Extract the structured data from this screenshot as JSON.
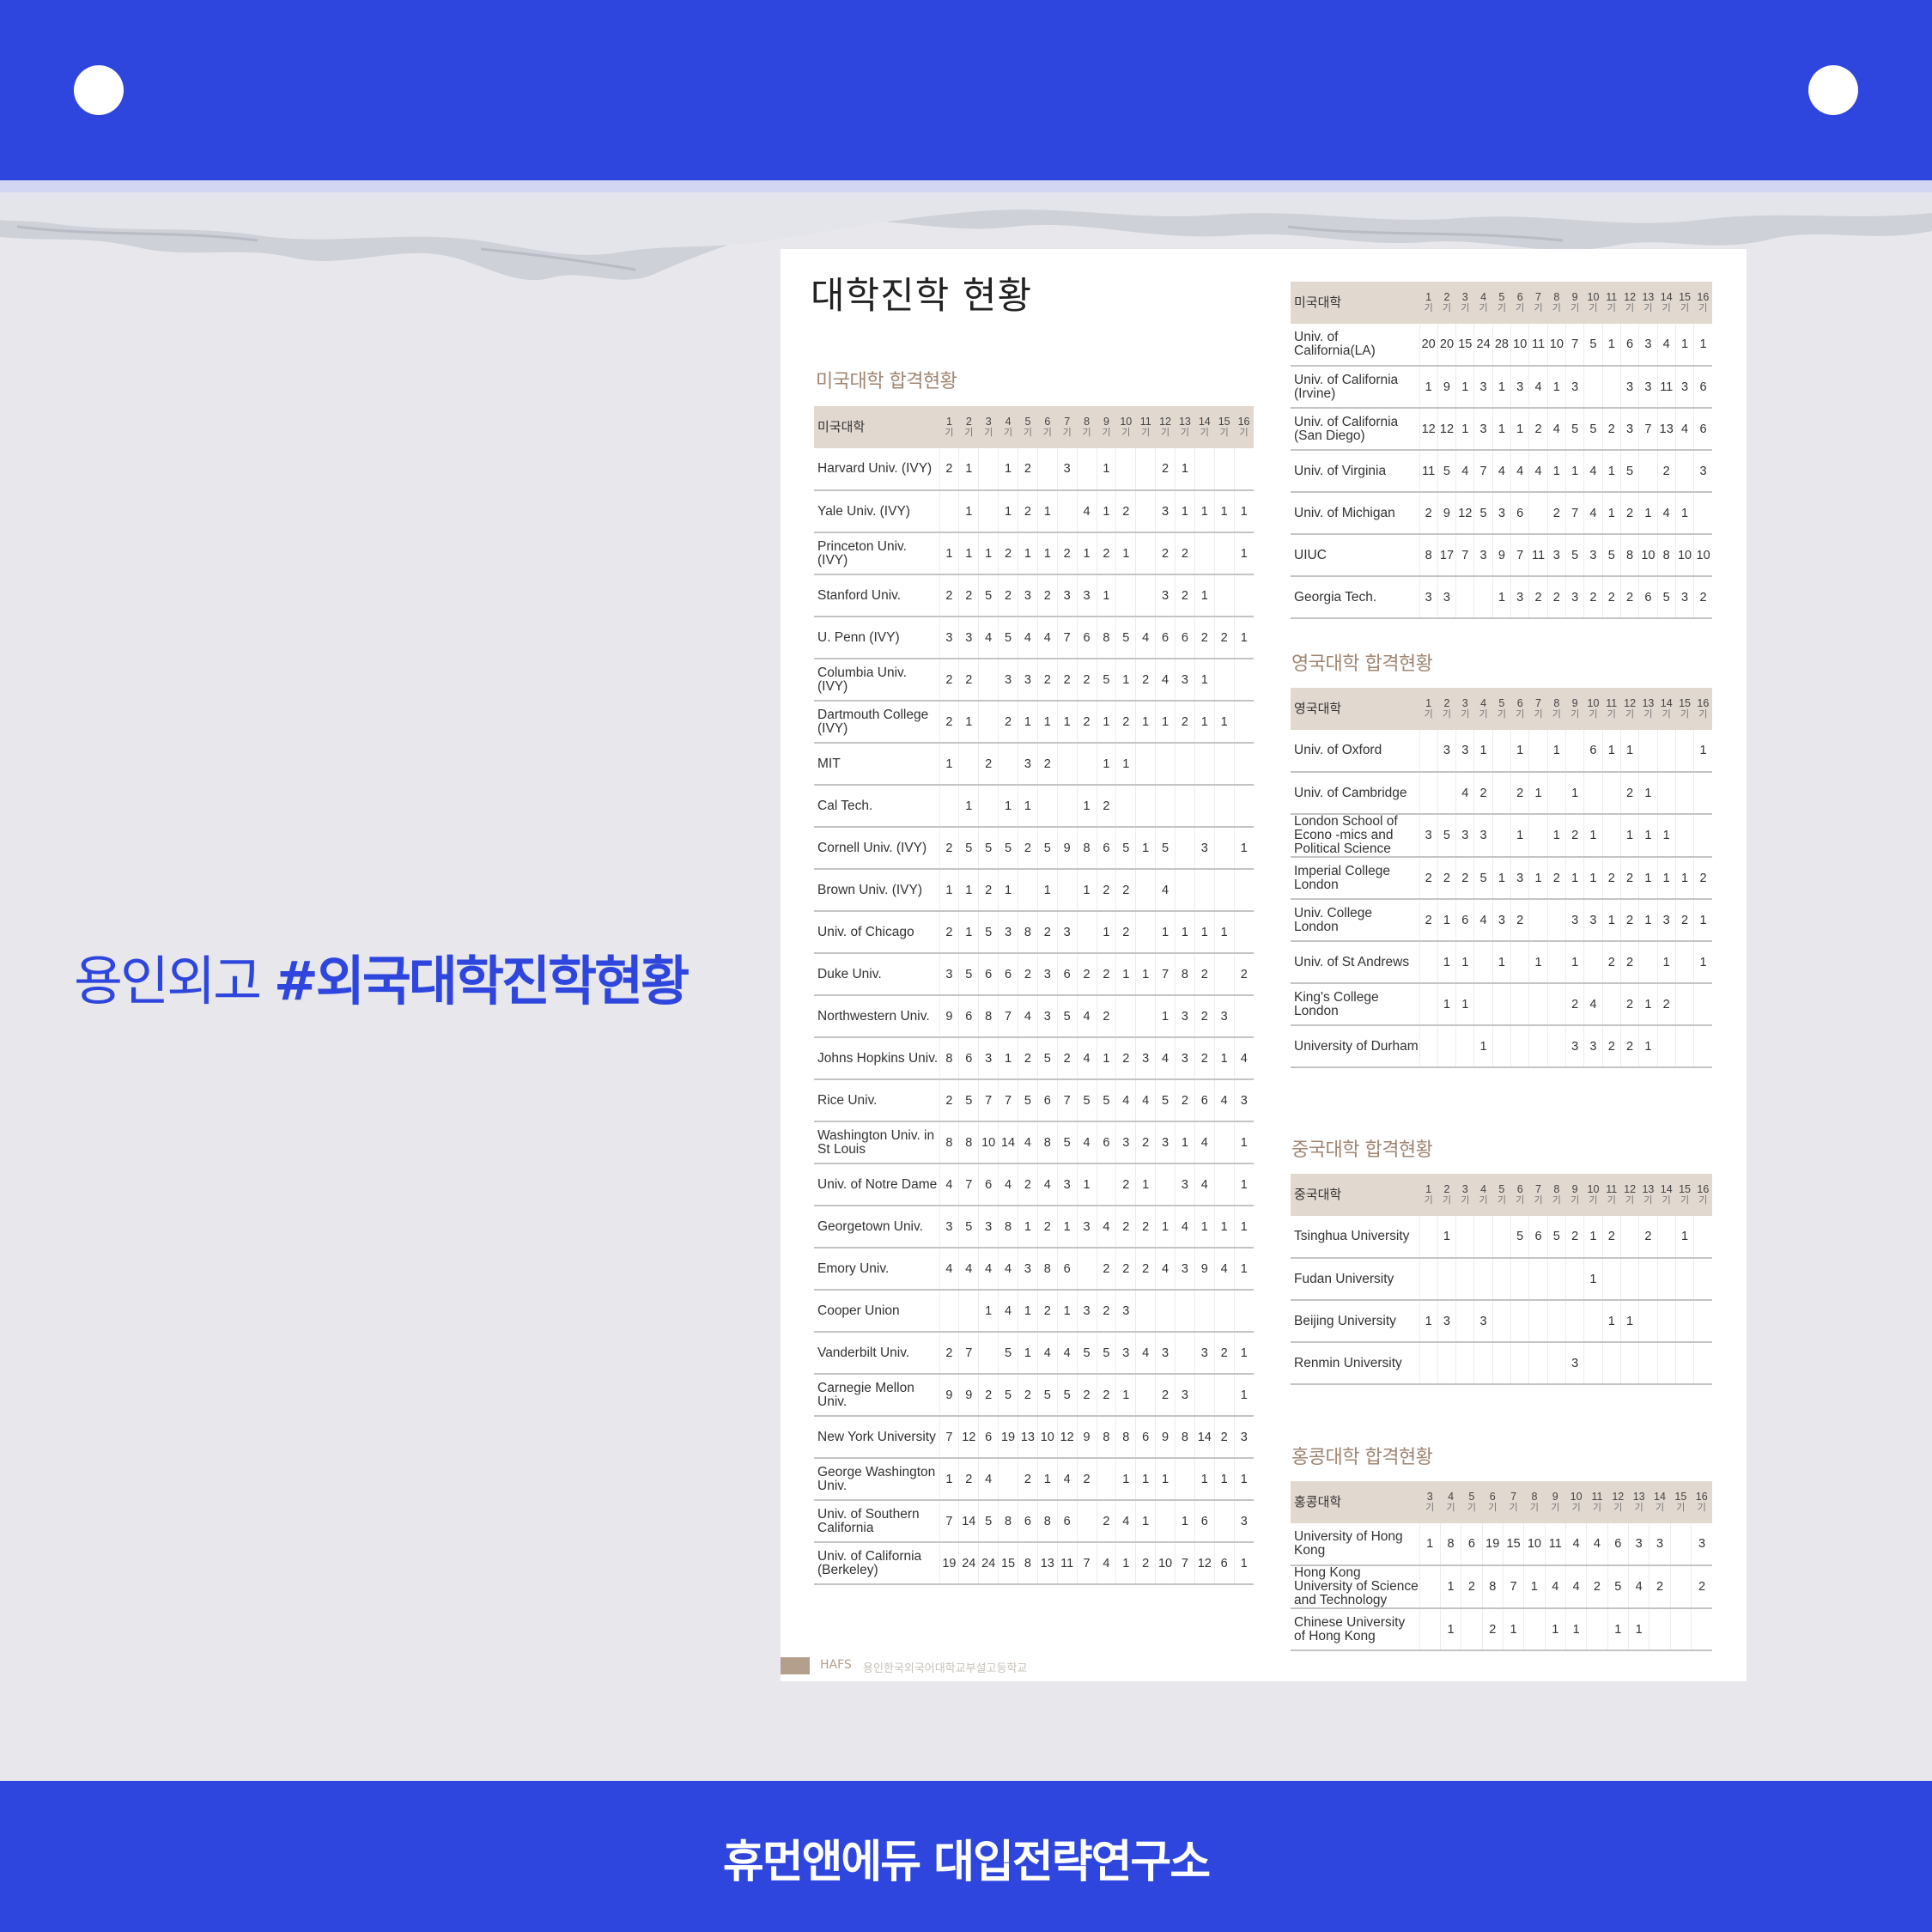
{
  "cols16": [
    "1",
    "2",
    "3",
    "4",
    "5",
    "6",
    "7",
    "8",
    "9",
    "10",
    "11",
    "12",
    "13",
    "14",
    "15",
    "16"
  ],
  "cols14": [
    "3",
    "4",
    "5",
    "6",
    "7",
    "8",
    "9",
    "10",
    "11",
    "12",
    "13",
    "14",
    "15",
    "16"
  ],
  "col_suffix": "기",
  "headline": {
    "prefix": "용인외고 ",
    "tag": "#외국대학진학현황"
  },
  "footer_bar": {
    "text": "휴먼앤에듀 대입전략연구소"
  },
  "doc": {
    "title": "대학진학 현황",
    "footer_brand": "HAFS",
    "footer_org": "용인한국외국어대학교부설고등학교"
  },
  "us_table_1": {
    "section_title": "미국대학 합격현황",
    "header": "미국대학",
    "rows": [
      {
        "name": "Harvard Univ. (IVY)",
        "cells": [
          "2",
          "1",
          "",
          "1",
          "2",
          "",
          "3",
          "",
          "1",
          "",
          "",
          "2",
          "1",
          "",
          "",
          ""
        ]
      },
      {
        "name": "Yale Univ. (IVY)",
        "cells": [
          "",
          "1",
          "",
          "1",
          "2",
          "1",
          "",
          "4",
          "1",
          "2",
          "",
          "3",
          "1",
          "1",
          "1",
          "1"
        ]
      },
      {
        "name": "Princeton Univ. (IVY)",
        "cells": [
          "1",
          "1",
          "1",
          "2",
          "1",
          "1",
          "2",
          "1",
          "2",
          "1",
          "",
          "2",
          "2",
          "",
          "",
          "1"
        ]
      },
      {
        "name": "Stanford Univ.",
        "cells": [
          "2",
          "2",
          "5",
          "2",
          "3",
          "2",
          "3",
          "3",
          "1",
          "",
          "",
          "3",
          "2",
          "1",
          "",
          ""
        ]
      },
      {
        "name": "U. Penn (IVY)",
        "cells": [
          "3",
          "3",
          "4",
          "5",
          "4",
          "4",
          "7",
          "6",
          "8",
          "5",
          "4",
          "6",
          "6",
          "2",
          "2",
          "1"
        ]
      },
      {
        "name": "Columbia Univ. (IVY)",
        "cells": [
          "2",
          "2",
          "",
          "3",
          "3",
          "2",
          "2",
          "2",
          "5",
          "1",
          "2",
          "4",
          "3",
          "1",
          "",
          ""
        ]
      },
      {
        "name": "Dartmouth College (IVY)",
        "cells": [
          "2",
          "1",
          "",
          "2",
          "1",
          "1",
          "1",
          "2",
          "1",
          "2",
          "1",
          "1",
          "2",
          "1",
          "1",
          ""
        ]
      },
      {
        "name": "MIT",
        "cells": [
          "1",
          "",
          "2",
          "",
          "3",
          "2",
          "",
          "",
          "1",
          "1",
          "",
          "",
          "",
          "",
          "",
          ""
        ]
      },
      {
        "name": "Cal Tech.",
        "cells": [
          "",
          "1",
          "",
          "1",
          "1",
          "",
          "",
          "1",
          "2",
          "",
          "",
          "",
          "",
          "",
          "",
          ""
        ]
      },
      {
        "name": "Cornell Univ. (IVY)",
        "cells": [
          "2",
          "5",
          "5",
          "5",
          "2",
          "5",
          "9",
          "8",
          "6",
          "5",
          "1",
          "5",
          "",
          "3",
          "",
          "1"
        ]
      },
      {
        "name": "Brown Univ. (IVY)",
        "cells": [
          "1",
          "1",
          "2",
          "1",
          "",
          "1",
          "",
          "1",
          "2",
          "2",
          "",
          "4",
          "",
          "",
          "",
          ""
        ]
      },
      {
        "name": "Univ. of Chicago",
        "cells": [
          "2",
          "1",
          "5",
          "3",
          "8",
          "2",
          "3",
          "",
          "1",
          "2",
          "",
          "1",
          "1",
          "1",
          "1",
          ""
        ]
      },
      {
        "name": "Duke Univ.",
        "cells": [
          "3",
          "5",
          "6",
          "6",
          "2",
          "3",
          "6",
          "2",
          "2",
          "1",
          "1",
          "7",
          "8",
          "2",
          "",
          "2"
        ]
      },
      {
        "name": "Northwestern Univ.",
        "cells": [
          "9",
          "6",
          "8",
          "7",
          "4",
          "3",
          "5",
          "4",
          "2",
          "",
          "",
          "1",
          "3",
          "2",
          "3",
          ""
        ]
      },
      {
        "name": "Johns Hopkins Univ.",
        "cells": [
          "8",
          "6",
          "3",
          "1",
          "2",
          "5",
          "2",
          "4",
          "1",
          "2",
          "3",
          "4",
          "3",
          "2",
          "1",
          "4"
        ]
      },
      {
        "name": "Rice Univ.",
        "cells": [
          "2",
          "5",
          "7",
          "7",
          "5",
          "6",
          "7",
          "5",
          "5",
          "4",
          "4",
          "5",
          "2",
          "6",
          "4",
          "3"
        ]
      },
      {
        "name": "Washington Univ. in St Louis",
        "cells": [
          "8",
          "8",
          "10",
          "14",
          "4",
          "8",
          "5",
          "4",
          "6",
          "3",
          "2",
          "3",
          "1",
          "4",
          "",
          "1"
        ]
      },
      {
        "name": "Univ. of Notre Dame",
        "cells": [
          "4",
          "7",
          "6",
          "4",
          "2",
          "4",
          "3",
          "1",
          "",
          "2",
          "1",
          "",
          "3",
          "4",
          "",
          "1"
        ]
      },
      {
        "name": "Georgetown Univ.",
        "cells": [
          "3",
          "5",
          "3",
          "8",
          "1",
          "2",
          "1",
          "3",
          "4",
          "2",
          "2",
          "1",
          "4",
          "1",
          "1",
          "1"
        ]
      },
      {
        "name": "Emory Univ.",
        "cells": [
          "4",
          "4",
          "4",
          "4",
          "3",
          "8",
          "6",
          "",
          "2",
          "2",
          "2",
          "4",
          "3",
          "9",
          "4",
          "1"
        ]
      },
      {
        "name": "Cooper Union",
        "cells": [
          "",
          "",
          "1",
          "4",
          "1",
          "2",
          "1",
          "3",
          "2",
          "3",
          "",
          "",
          "",
          "",
          "",
          ""
        ]
      },
      {
        "name": "Vanderbilt Univ.",
        "cells": [
          "2",
          "7",
          "",
          "5",
          "1",
          "4",
          "4",
          "5",
          "5",
          "3",
          "4",
          "3",
          "",
          "3",
          "2",
          "1"
        ]
      },
      {
        "name": "Carnegie Mellon Univ.",
        "cells": [
          "9",
          "9",
          "2",
          "5",
          "2",
          "5",
          "5",
          "2",
          "2",
          "1",
          "",
          "2",
          "3",
          "",
          "",
          "1"
        ]
      },
      {
        "name": "New York University",
        "cells": [
          "7",
          "12",
          "6",
          "19",
          "13",
          "10",
          "12",
          "9",
          "8",
          "8",
          "6",
          "9",
          "8",
          "14",
          "2",
          "3"
        ]
      },
      {
        "name": "George Washington Univ.",
        "cells": [
          "1",
          "2",
          "4",
          "",
          "2",
          "1",
          "4",
          "2",
          "",
          "1",
          "1",
          "1",
          "",
          "1",
          "1",
          "1"
        ]
      },
      {
        "name": "Univ. of Southern California",
        "cells": [
          "7",
          "14",
          "5",
          "8",
          "6",
          "8",
          "6",
          "",
          "2",
          "4",
          "1",
          "",
          "1",
          "6",
          "",
          "3"
        ]
      },
      {
        "name": "Univ. of California (Berkeley)",
        "cells": [
          "19",
          "24",
          "24",
          "15",
          "8",
          "13",
          "11",
          "7",
          "4",
          "1",
          "2",
          "10",
          "7",
          "12",
          "6",
          "1"
        ]
      }
    ]
  },
  "us_table_2": {
    "header": "미국대학",
    "rows": [
      {
        "name": "Univ. of California(LA)",
        "cells": [
          "20",
          "20",
          "15",
          "24",
          "28",
          "10",
          "11",
          "10",
          "7",
          "5",
          "1",
          "6",
          "3",
          "4",
          "1",
          "1"
        ]
      },
      {
        "name": "Univ. of California (Irvine)",
        "cells": [
          "1",
          "9",
          "1",
          "3",
          "1",
          "3",
          "4",
          "1",
          "3",
          "",
          "",
          "3",
          "3",
          "11",
          "3",
          "6"
        ]
      },
      {
        "name": "Univ. of California (San Diego)",
        "cells": [
          "12",
          "12",
          "1",
          "3",
          "1",
          "1",
          "2",
          "4",
          "5",
          "5",
          "2",
          "3",
          "7",
          "13",
          "4",
          "6"
        ]
      },
      {
        "name": "Univ. of Virginia",
        "cells": [
          "11",
          "5",
          "4",
          "7",
          "4",
          "4",
          "4",
          "1",
          "1",
          "4",
          "1",
          "5",
          "",
          "2",
          "",
          "3"
        ]
      },
      {
        "name": "Univ. of Michigan",
        "cells": [
          "2",
          "9",
          "12",
          "5",
          "3",
          "6",
          "",
          "2",
          "7",
          "4",
          "1",
          "2",
          "1",
          "4",
          "1",
          ""
        ]
      },
      {
        "name": "UIUC",
        "cells": [
          "8",
          "17",
          "7",
          "3",
          "9",
          "7",
          "11",
          "3",
          "5",
          "3",
          "5",
          "8",
          "10",
          "8",
          "10",
          "10"
        ]
      },
      {
        "name": "Georgia Tech.",
        "cells": [
          "3",
          "3",
          "",
          "",
          "1",
          "3",
          "2",
          "2",
          "3",
          "2",
          "2",
          "2",
          "6",
          "5",
          "3",
          "2"
        ]
      }
    ]
  },
  "uk_table": {
    "section_title": "영국대학 합격현황",
    "header": "영국대학",
    "rows": [
      {
        "name": "Univ. of Oxford",
        "cells": [
          "",
          "3",
          "3",
          "1",
          "",
          "1",
          "",
          "1",
          "",
          "6",
          "1",
          "1",
          "",
          "",
          "",
          "1"
        ]
      },
      {
        "name": "Univ. of Cambridge",
        "cells": [
          "",
          "",
          "4",
          "2",
          "",
          "2",
          "1",
          "",
          "1",
          "",
          "",
          "2",
          "1",
          "",
          "",
          ""
        ]
      },
      {
        "name": "London School of Econo -mics and Political Science",
        "cells": [
          "3",
          "5",
          "3",
          "3",
          "",
          "1",
          "",
          "1",
          "2",
          "1",
          "",
          "1",
          "1",
          "1",
          "",
          ""
        ]
      },
      {
        "name": "Imperial College London",
        "cells": [
          "2",
          "2",
          "2",
          "5",
          "1",
          "3",
          "1",
          "2",
          "1",
          "1",
          "2",
          "2",
          "1",
          "1",
          "1",
          "2"
        ]
      },
      {
        "name": "Univ. College London",
        "cells": [
          "2",
          "1",
          "6",
          "4",
          "3",
          "2",
          "",
          "",
          "3",
          "3",
          "1",
          "2",
          "1",
          "3",
          "2",
          "1"
        ]
      },
      {
        "name": "Univ. of St Andrews",
        "cells": [
          "",
          "1",
          "1",
          "",
          "1",
          "",
          "1",
          "",
          "1",
          "",
          "2",
          "2",
          "",
          "1",
          "",
          "1"
        ]
      },
      {
        "name": "King's College London",
        "cells": [
          "",
          "1",
          "1",
          "",
          "",
          "",
          "",
          "",
          "2",
          "4",
          "",
          "2",
          "1",
          "2",
          "",
          ""
        ]
      },
      {
        "name": "University of Durham",
        "cells": [
          "",
          "",
          "",
          "1",
          "",
          "",
          "",
          "",
          "3",
          "3",
          "2",
          "2",
          "1",
          "",
          "",
          ""
        ]
      }
    ]
  },
  "cn_table": {
    "section_title": "중국대학 합격현황",
    "header": "중국대학",
    "rows": [
      {
        "name": "Tsinghua University",
        "cells": [
          "",
          "1",
          "",
          "",
          "",
          "5",
          "6",
          "5",
          "2",
          "1",
          "2",
          "",
          "2",
          "",
          "1",
          ""
        ]
      },
      {
        "name": "Fudan University",
        "cells": [
          "",
          "",
          "",
          "",
          "",
          "",
          "",
          "",
          "",
          "1",
          "",
          "",
          "",
          "",
          "",
          ""
        ]
      },
      {
        "name": "Beijing University",
        "cells": [
          "1",
          "3",
          "",
          "3",
          "",
          "",
          "",
          "",
          "",
          "",
          "1",
          "1",
          "",
          "",
          "",
          ""
        ]
      },
      {
        "name": "Renmin University",
        "cells": [
          "",
          "",
          "",
          "",
          "",
          "",
          "",
          "",
          "3",
          "",
          "",
          "",
          "",
          "",
          "",
          ""
        ]
      }
    ]
  },
  "hk_table": {
    "section_title": "홍콩대학 합격현황",
    "header": "홍콩대학",
    "rows": [
      {
        "name": "University of Hong Kong",
        "cells": [
          "1",
          "8",
          "6",
          "19",
          "15",
          "10",
          "11",
          "4",
          "4",
          "6",
          "3",
          "3",
          "",
          "3"
        ]
      },
      {
        "name": "Hong Kong University of Science and Technology",
        "cells": [
          "",
          "1",
          "2",
          "8",
          "7",
          "1",
          "4",
          "4",
          "2",
          "5",
          "4",
          "2",
          "",
          "2"
        ]
      },
      {
        "name": "Chinese University of Hong Kong",
        "cells": [
          "",
          "1",
          "",
          "2",
          "1",
          "",
          "1",
          "1",
          "",
          "1",
          "1",
          "",
          "",
          ""
        ]
      }
    ]
  }
}
